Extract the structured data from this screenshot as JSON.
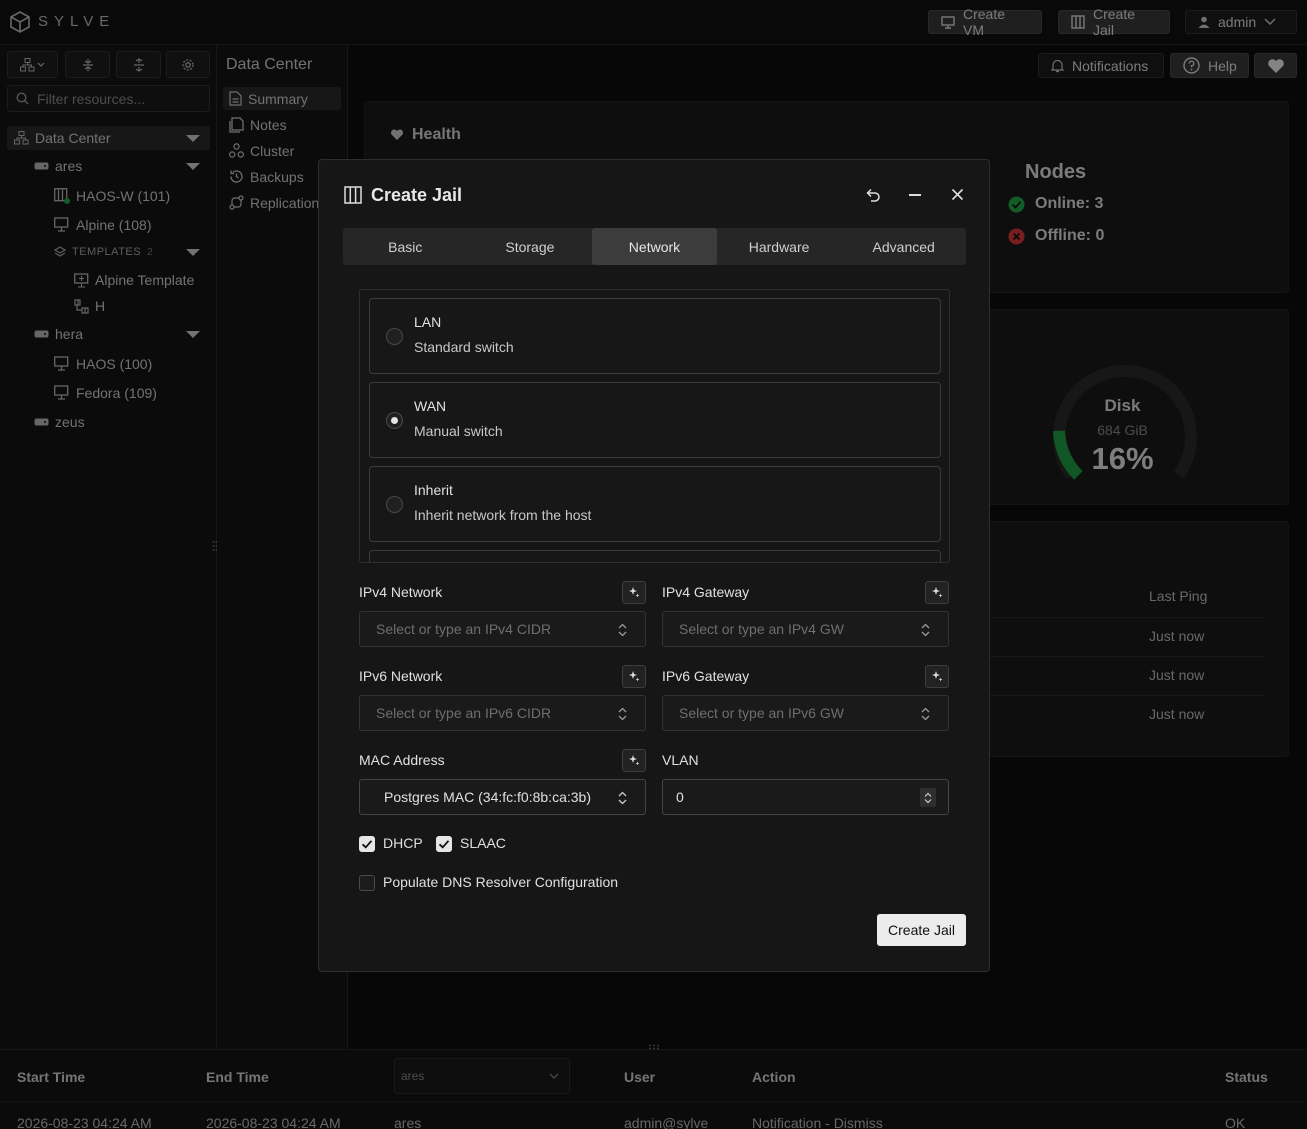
{
  "app": {
    "logo_text": "SYLVE"
  },
  "header": {
    "create_vm": "Create VM",
    "create_jail": "Create Jail",
    "user": "admin",
    "notifications": "Notifications",
    "help": "Help"
  },
  "sidebar": {
    "filter_placeholder": "Filter resources...",
    "tree": {
      "root": "Data Center",
      "ares": "ares",
      "haos_w": "HAOS-W (101)",
      "alpine": "Alpine (108)",
      "templates": "TEMPLATES",
      "templates_count": "2",
      "alpine_template": "Alpine Template",
      "h": "H",
      "hera": "hera",
      "haos": "HAOS (100)",
      "fedora": "Fedora (109)",
      "zeus": "zeus"
    }
  },
  "nav2": {
    "items": [
      "Summary",
      "Notes",
      "Cluster",
      "Backups",
      "Replication"
    ]
  },
  "main": {
    "title": "Data Center",
    "health": "Health",
    "nodes": {
      "title": "Nodes",
      "online": "Online: 3",
      "offline": "Offline: 0"
    },
    "disk": {
      "label": "Disk",
      "size": "684 GiB",
      "percent": "16%",
      "fraction": 0.16
    },
    "ping": {
      "header": "Last Ping",
      "rows": [
        "Just now",
        "Just now",
        "Just now"
      ]
    }
  },
  "bottom_table": {
    "headers": {
      "start": "Start Time",
      "end": "End Time",
      "node_filter": "ares",
      "user": "User",
      "action": "Action",
      "status": "Status"
    },
    "row": {
      "start": "2026-08-23 04:24 AM",
      "end": "2026-08-23 04:24 AM",
      "node": "ares",
      "user": "admin@sylve",
      "action": "Notification - Dismiss",
      "status": "OK"
    }
  },
  "modal": {
    "title": "Create Jail",
    "tabs": [
      "Basic",
      "Storage",
      "Network",
      "Hardware",
      "Advanced"
    ],
    "active_tab": "Network",
    "network_options": [
      {
        "title": "LAN",
        "subtitle": "Standard switch",
        "selected": false
      },
      {
        "title": "WAN",
        "subtitle": "Manual switch",
        "selected": true
      },
      {
        "title": "Inherit",
        "subtitle": "Inherit network from the host",
        "selected": false
      }
    ],
    "ipv4_network": {
      "label": "IPv4 Network",
      "placeholder": "Select or type an IPv4 CIDR"
    },
    "ipv4_gateway": {
      "label": "IPv4 Gateway",
      "placeholder": "Select or type an IPv4 GW"
    },
    "ipv6_network": {
      "label": "IPv6 Network",
      "placeholder": "Select or type an IPv6 CIDR"
    },
    "ipv6_gateway": {
      "label": "IPv6 Gateway",
      "placeholder": "Select or type an IPv6 GW"
    },
    "mac": {
      "label": "MAC Address",
      "value": "Postgres MAC (34:fc:f0:8b:ca:3b)"
    },
    "vlan": {
      "label": "VLAN",
      "value": "0"
    },
    "dhcp": {
      "label": "DHCP",
      "checked": true
    },
    "slaac": {
      "label": "SLAAC",
      "checked": true
    },
    "dns": {
      "label": "Populate DNS Resolver Configuration",
      "checked": false
    },
    "submit": "Create Jail"
  },
  "colors": {
    "online": "#22a84a",
    "offline": "#d93a3a",
    "disk_arc": "#1f9e45",
    "accent_button": "#ececec"
  }
}
